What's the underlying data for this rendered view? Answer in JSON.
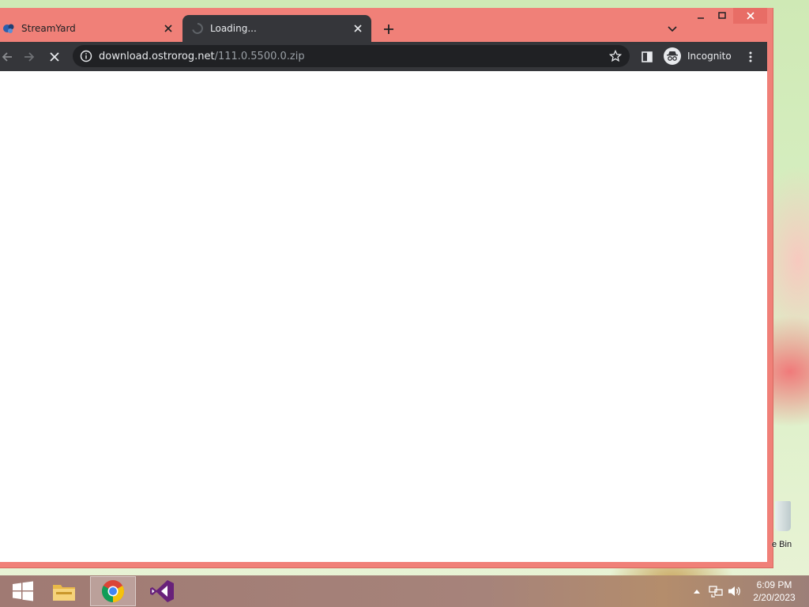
{
  "tabs": [
    {
      "title": "StreamYard",
      "favicon": "streamyard-icon",
      "active": false
    },
    {
      "title": "Loading...",
      "favicon": "loading-spinner-icon",
      "active": true
    }
  ],
  "omnibox": {
    "url_host": "download.ostrorog.net",
    "url_path": "/111.0.5500.0.zip"
  },
  "profile": {
    "label": "Incognito"
  },
  "desktop": {
    "recycle_bin_label": "e Bin"
  },
  "taskbar": {
    "apps": [
      "file-explorer-icon",
      "chrome-icon",
      "visual-studio-icon"
    ],
    "clock_time": "6:09 PM",
    "clock_date": "2/20/2023"
  },
  "colors": {
    "window_frame": "#f08078",
    "toolbar": "#35363a",
    "omnibox": "#202124"
  }
}
